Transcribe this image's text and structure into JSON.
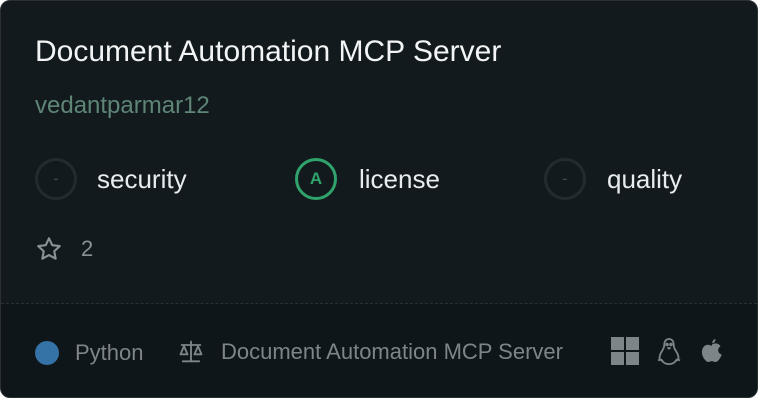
{
  "card": {
    "title": "Document Automation MCP Server",
    "author": "vedantparmar12",
    "scores": [
      {
        "label": "security",
        "grade": "-",
        "state": "none"
      },
      {
        "label": "license",
        "grade": "A",
        "state": "good"
      },
      {
        "label": "quality",
        "grade": "-",
        "state": "none"
      }
    ],
    "stars": "2",
    "language": {
      "name": "Python",
      "color": "#3572a5"
    },
    "license_text": "Document Automation MCP Server",
    "platforms": [
      "windows-icon",
      "linux-icon",
      "apple-icon"
    ],
    "colors": {
      "background": "#121a1d",
      "author": "#5f8577",
      "grade_good": "#2fa36b"
    }
  }
}
